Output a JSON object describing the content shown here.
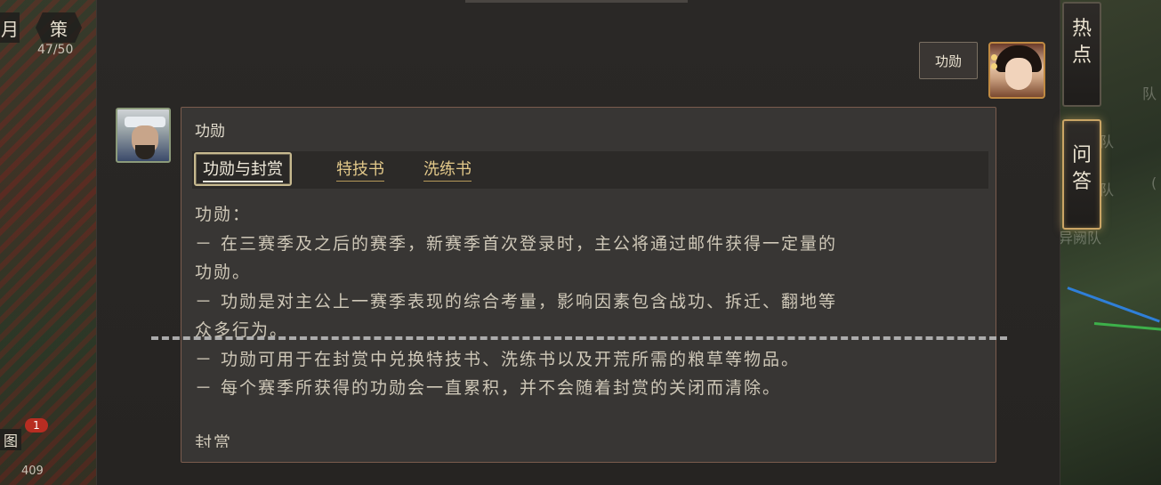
{
  "hud": {
    "yue": "月",
    "ce": "策",
    "stamina": "47/50",
    "map_icon": "图",
    "mail_badge": "1",
    "bottom_count": "409"
  },
  "bg_right_labels": [
    "队",
    "队",
    "队",
    "(",
    "异阙队"
  ],
  "side_tabs": {
    "hot": [
      "热",
      "点"
    ],
    "qa": [
      "问",
      "答"
    ]
  },
  "speaker_bubble": "功勋",
  "dialog": {
    "title": "功勋",
    "tabs": [
      {
        "label": "功勋与封赏",
        "active": true
      },
      {
        "label": "特技书",
        "active": false
      },
      {
        "label": "洗练书",
        "active": false
      }
    ],
    "lines": [
      "功勋：",
      "－ 在三赛季及之后的赛季，新赛季首次登录时，主公将通过邮件获得一定量的",
      "功勋。",
      "－ 功勋是对主公上一赛季表现的综合考量，影响因素包含战功、拆迁、翻地等",
      "众多行为。",
      "－ 功勋可用于在封赏中兑换特技书、洗练书以及开荒所需的粮草等物品。",
      "－ 每个赛季所获得的功勋会一直累积，并不会随着封赏的关闭而清除。"
    ],
    "next_heading": "封赏"
  },
  "colors": {
    "panel_bg": "#383634",
    "tab_gold": "#e3c98a",
    "glow": "#caa565"
  }
}
